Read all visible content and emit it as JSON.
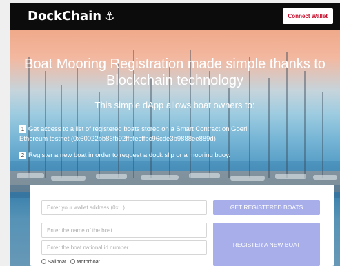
{
  "navbar": {
    "brand": "DockChain",
    "brand_icon": "anchor-icon",
    "connect_label": "Connect Wallet",
    "connect_color": "#c8102e"
  },
  "hero": {
    "title": "Boat Mooring Registration made simple thanks to Blockchain technology",
    "subtitle": "This simple dApp allows boat owners to:",
    "features": [
      {
        "number": "1",
        "text": "Get access to a list of registered boats stored on a Smart Contract on Goerli Ethereum testnet (0x60022bb86fb92ffbfecffbc96cde3b9888ee889d)"
      },
      {
        "number": "2",
        "text": "Register a new boat in order to request a dock slip or a mooring buoy."
      }
    ]
  },
  "form": {
    "wallet_placeholder": "Enter your wallet address (0x...)",
    "get_boats_label": "GET REGISTERED BOATS",
    "boat_name_placeholder": "Enter the name of the boat",
    "boat_id_placeholder": "Enter the boat national id number",
    "register_label": "REGISTER A NEW BOAT",
    "boat_types": [
      "Sailboat",
      "Motorboat"
    ],
    "button_color": "#a7aee9"
  }
}
